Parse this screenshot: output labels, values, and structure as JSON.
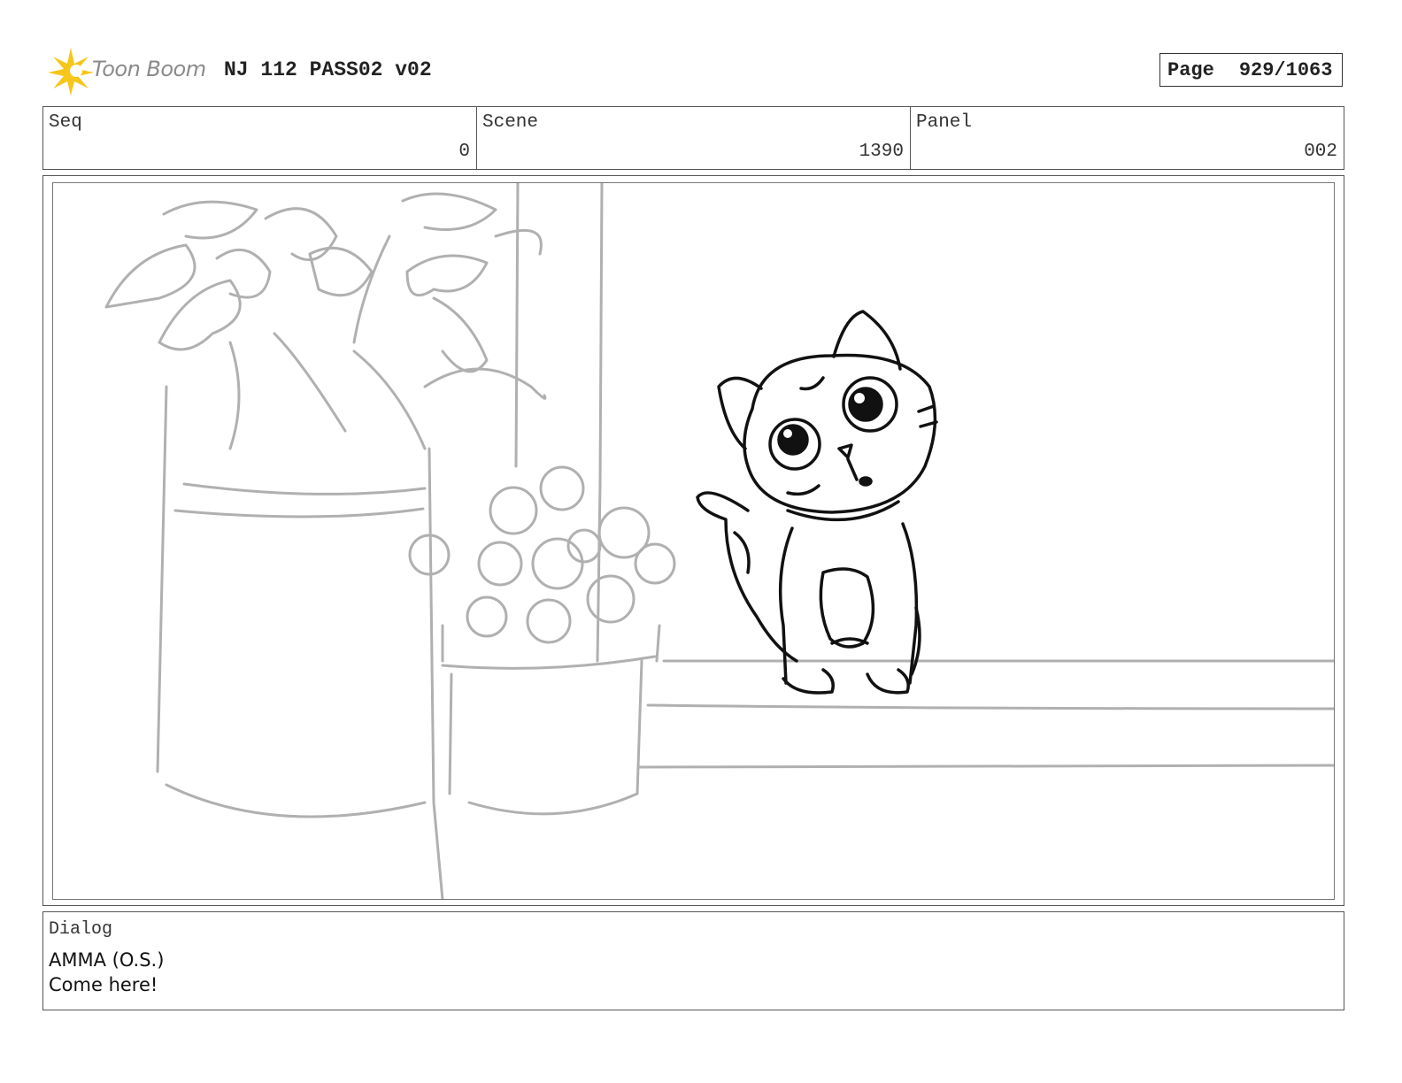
{
  "header": {
    "logo_text": "Toon Boom",
    "project_title": "NJ 112 PASS02 v02",
    "page_label": "Page",
    "page_number": "929/1063"
  },
  "info": {
    "seq_label": "Seq",
    "seq_value": "0",
    "scene_label": "Scene",
    "scene_value": "1390",
    "panel_label": "Panel",
    "panel_value": "002"
  },
  "dialog": {
    "label": "Dialog",
    "line1": "AMMA (O.S.)",
    "line2": "Come here!"
  },
  "colors": {
    "logo_star": "#f7c61a",
    "sketch_light": "#b0b0b0",
    "sketch_dark": "#111111"
  }
}
